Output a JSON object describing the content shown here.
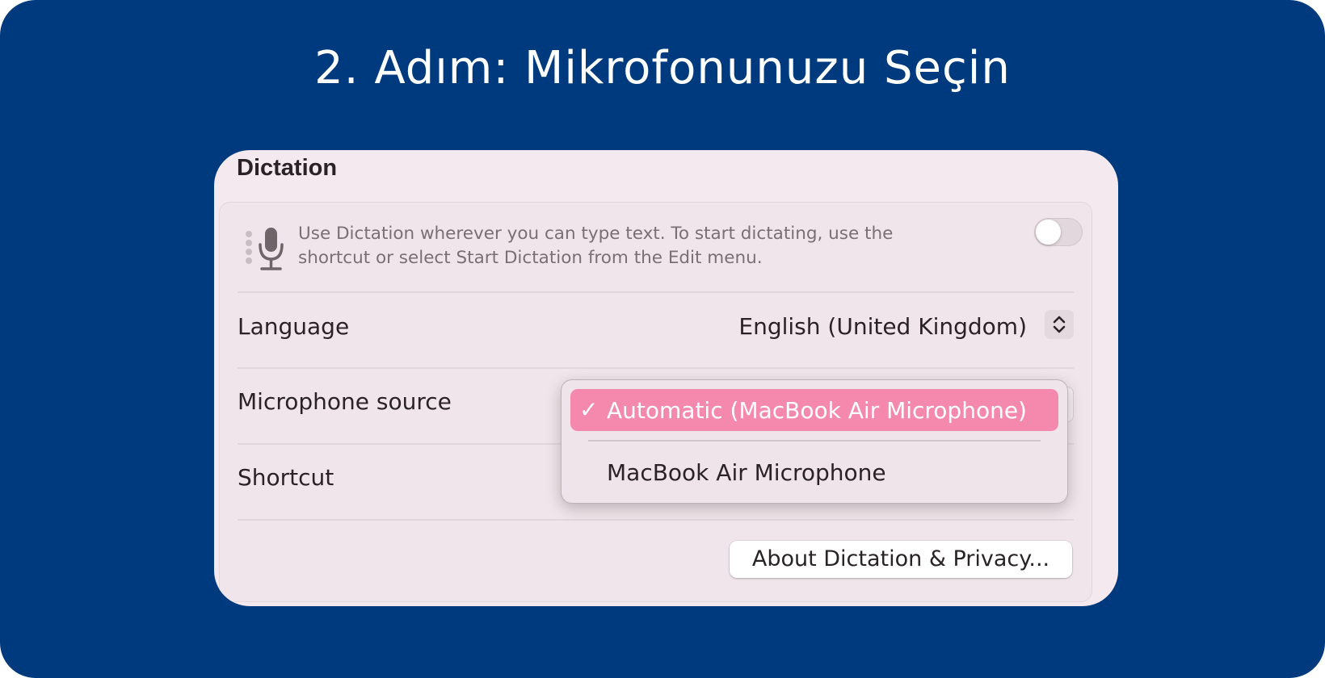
{
  "banner": {
    "title": "2. Adım: Mikrofonunuzu Seçin"
  },
  "dictation": {
    "section_title": "Dictation",
    "description": "Use Dictation wherever you can type text. To start dictating, use the shortcut or select Start Dictation from the Edit menu.",
    "toggle_on": false,
    "language": {
      "label": "Language",
      "value": "English (United Kingdom)"
    },
    "microphone": {
      "label": "Microphone source"
    },
    "shortcut": {
      "label": "Shortcut"
    },
    "about_button": "About Dictation & Privacy..."
  },
  "microphone_menu": {
    "check_glyph": "✓",
    "selected_option": "Automatic (MacBook Air Microphone)",
    "other_option": "MacBook Air Microphone"
  },
  "icons": [
    "microphone-icon",
    "updown-chevron-icon",
    "checkmark-icon"
  ],
  "colors": {
    "background": "#003a7e",
    "panel": "#f3e9ee",
    "menu_highlight": "#f589ad"
  }
}
